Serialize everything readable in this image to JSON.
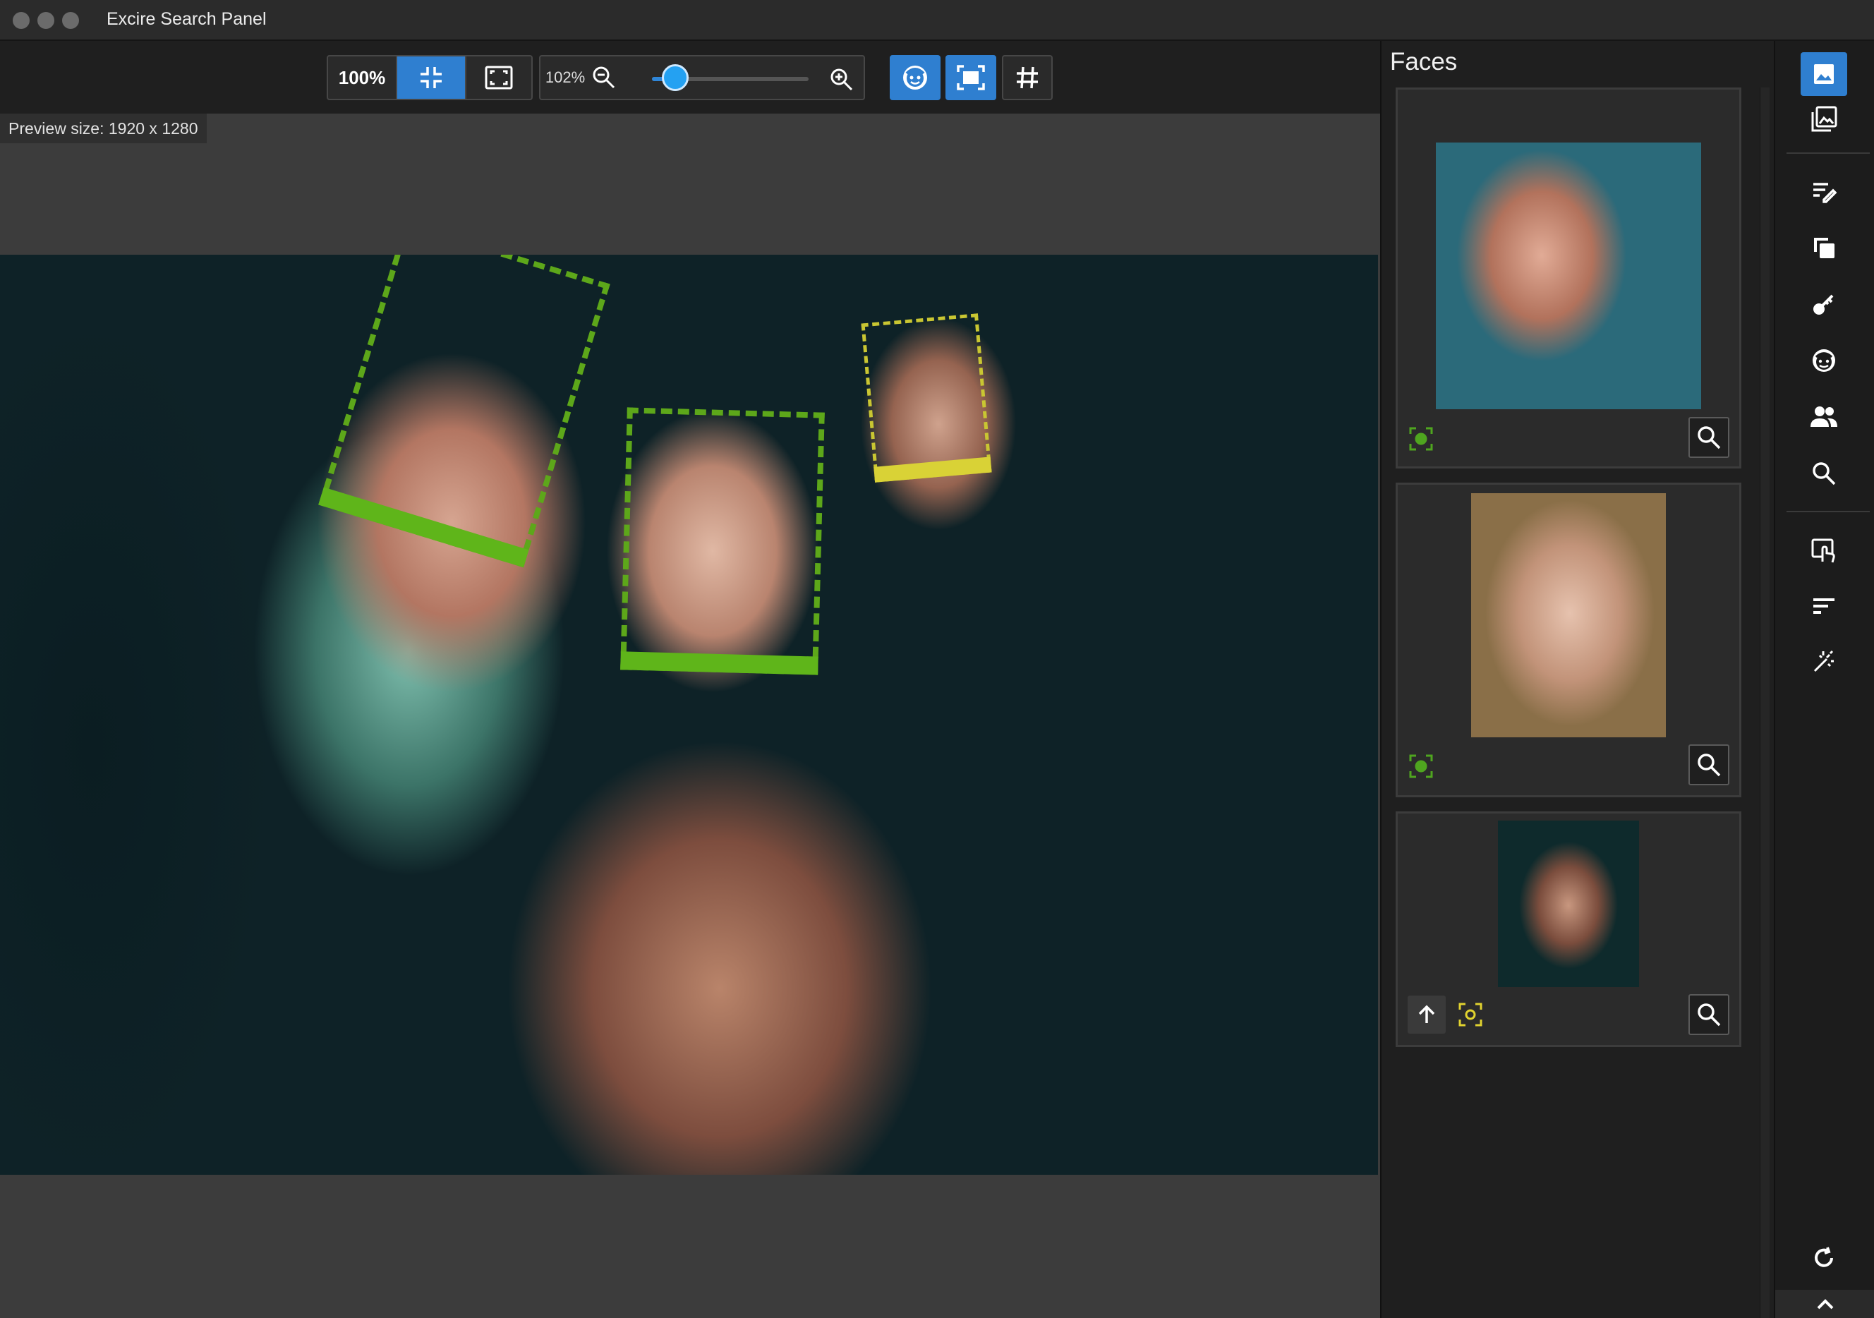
{
  "window": {
    "title": "Excire Search Panel"
  },
  "toolbar": {
    "zoom_100_label": "100%",
    "zoom_value": "102%",
    "zoom_slider_fraction": 0.15,
    "accent_color": "#2f7fd0",
    "icons": [
      "shrink-icon",
      "fit-frame-icon",
      "zoom-out-icon",
      "zoom-in-icon",
      "face-detect-icon",
      "focus-frame-icon",
      "grid-icon"
    ]
  },
  "viewer": {
    "preview_size": "Preview size: 1920 x 1280",
    "face_boxes": [
      {
        "color": "#5da71a",
        "state": "confirmed"
      },
      {
        "color": "#5da71a",
        "state": "confirmed"
      },
      {
        "color": "#d9d236",
        "state": "unconfirmed"
      }
    ]
  },
  "faces_panel": {
    "title": "Faces",
    "cards": [
      {
        "status_icon": "face-target-green-icon",
        "status_color": "#4fa51f"
      },
      {
        "status_icon": "face-target-green-icon",
        "status_color": "#4fa51f"
      },
      {
        "status_icon": "face-target-yellow-icon",
        "status_color": "#e0d22f",
        "has_up_button": true
      }
    ]
  },
  "rail": {
    "items": [
      "single-image-icon",
      "image-stack-icon",
      "edit-list-icon",
      "duplicates-icon",
      "keyword-icon",
      "face-icon",
      "people-icon",
      "search-icon",
      "touch-select-icon",
      "sort-icon",
      "magic-icon",
      "refresh-icon",
      "chevron-up-icon"
    ]
  }
}
